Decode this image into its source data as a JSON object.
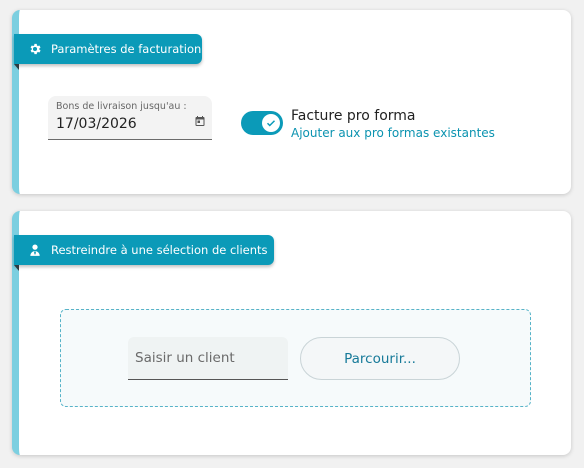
{
  "billing_card": {
    "title": "Paramètres de facturation",
    "title_icon": "gear-icon",
    "date_field": {
      "label": "Bons de livraison jusqu'au :",
      "value": "17/03/2026",
      "icon": "calendar-icon"
    },
    "proforma_toggle": {
      "checked": true,
      "title": "Facture pro forma",
      "subtitle": "Ajouter aux pro formas existantes"
    }
  },
  "clients_card": {
    "title": "Restreindre à une sélection de clients",
    "title_icon": "person-icon",
    "client_input_placeholder": "Saisir un client",
    "browse_label": "Parcourir..."
  },
  "colors": {
    "accent": "#0b9ab8",
    "card_border": "#7ccfe0",
    "link": "#0b93b0"
  }
}
